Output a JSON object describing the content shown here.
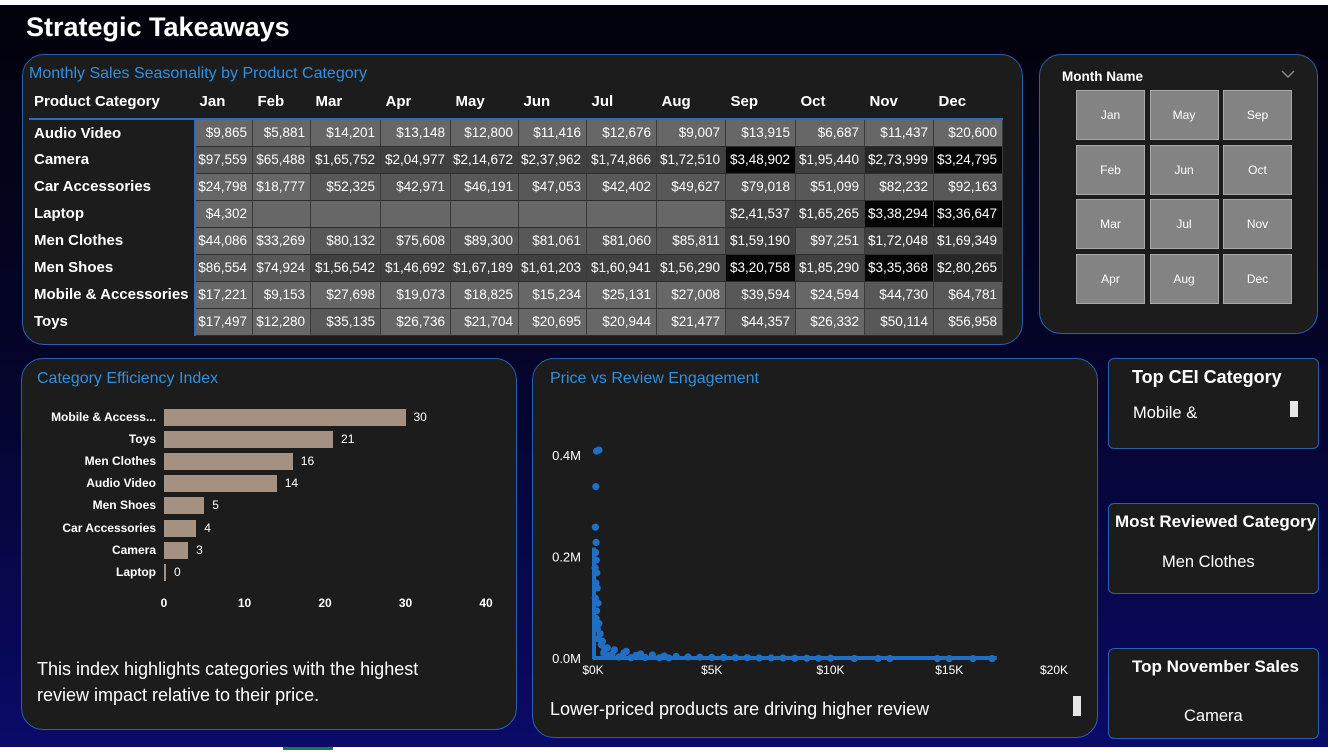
{
  "page": {
    "title": "Strategic Takeaways"
  },
  "seasonality": {
    "title": "Monthly Sales Seasonality by Product Category",
    "header": [
      "Product Category",
      "Jan",
      "Feb",
      "Mar",
      "Apr",
      "May",
      "Jun",
      "Jul",
      "Aug",
      "Sep",
      "Oct",
      "Nov",
      "Dec"
    ],
    "rows": [
      {
        "name": "Audio Video",
        "cells": [
          "$9,865",
          "$5,881",
          "$14,201",
          "$13,148",
          "$12,800",
          "$11,416",
          "$12,676",
          "$9,007",
          "$13,915",
          "$6,687",
          "$11,437",
          "$20,600"
        ],
        "shade": [
          1,
          1,
          1,
          1,
          1,
          1,
          1,
          1,
          1,
          1,
          1,
          1
        ]
      },
      {
        "name": "Camera",
        "cells": [
          "$97,559",
          "$65,488",
          "$1,65,752",
          "$2,04,977",
          "$2,14,672",
          "$2,37,962",
          "$1,74,866",
          "$1,72,510",
          "$3,48,902",
          "$1,95,440",
          "$2,73,999",
          "$3,24,795"
        ],
        "shade": [
          2,
          2,
          3,
          3,
          3,
          3,
          3,
          3,
          5,
          3,
          4,
          5
        ]
      },
      {
        "name": "Car Accessories",
        "cells": [
          "$24,798",
          "$18,777",
          "$52,325",
          "$42,971",
          "$46,191",
          "$47,053",
          "$42,402",
          "$49,627",
          "$79,018",
          "$51,099",
          "$82,232",
          "$92,163"
        ],
        "shade": [
          1,
          1,
          2,
          2,
          2,
          2,
          2,
          2,
          2,
          2,
          2,
          2
        ]
      },
      {
        "name": "Laptop",
        "cells": [
          "$4,302",
          "",
          "",
          "",
          "",
          "",
          "",
          "",
          "$2,41,537",
          "$1,65,265",
          "$3,38,294",
          "$3,36,647"
        ],
        "shade": [
          1,
          1,
          1,
          1,
          1,
          1,
          1,
          1,
          3,
          3,
          5,
          5
        ]
      },
      {
        "name": "Men Clothes",
        "cells": [
          "$44,086",
          "$33,269",
          "$80,132",
          "$75,608",
          "$89,300",
          "$81,061",
          "$81,060",
          "$85,811",
          "$1,59,190",
          "$97,251",
          "$1,72,048",
          "$1,69,349"
        ],
        "shade": [
          1,
          1,
          2,
          2,
          2,
          2,
          2,
          2,
          3,
          2,
          3,
          3
        ]
      },
      {
        "name": "Men Shoes",
        "cells": [
          "$86,554",
          "$74,924",
          "$1,56,542",
          "$1,46,692",
          "$1,67,189",
          "$1,61,203",
          "$1,60,941",
          "$1,56,290",
          "$3,20,758",
          "$1,85,290",
          "$3,35,368",
          "$2,80,265"
        ],
        "shade": [
          2,
          2,
          3,
          3,
          3,
          3,
          3,
          3,
          5,
          3,
          5,
          4
        ]
      },
      {
        "name": "Mobile & Accessories",
        "cells": [
          "$17,221",
          "$9,153",
          "$27,698",
          "$19,073",
          "$18,825",
          "$15,234",
          "$25,131",
          "$27,008",
          "$39,594",
          "$24,594",
          "$44,730",
          "$64,781"
        ],
        "shade": [
          1,
          1,
          1,
          1,
          1,
          1,
          1,
          1,
          2,
          1,
          2,
          2
        ]
      },
      {
        "name": "Toys",
        "cells": [
          "$17,497",
          "$12,280",
          "$35,135",
          "$26,736",
          "$21,704",
          "$20,695",
          "$20,944",
          "$21,477",
          "$44,357",
          "$26,332",
          "$50,114",
          "$56,958"
        ],
        "shade": [
          1,
          1,
          2,
          1,
          1,
          1,
          1,
          1,
          2,
          1,
          2,
          2
        ]
      }
    ],
    "shade_colors": [
      "#1c1c1c",
      "#676767",
      "#585858",
      "#404040",
      "#262626",
      "#050505"
    ]
  },
  "slicer": {
    "title": "Month Name",
    "chevron_icon": "chevron-down-icon",
    "months": [
      "Jan",
      "May",
      "Sep",
      "Feb",
      "Jun",
      "Oct",
      "Mar",
      "Jul",
      "Nov",
      "Apr",
      "Aug",
      "Dec"
    ]
  },
  "cei": {
    "title": "Category Efficiency Index",
    "caption_line1": "This index highlights categories with the highest",
    "caption_line2": "review impact relative to their price."
  },
  "scatter": {
    "title": "Price vs Review Engagement",
    "caption": "Lower-priced products are driving higher review",
    "point_color": "#1f6fc4"
  },
  "cards": {
    "top_cei": {
      "title": "Top CEI Category",
      "value": "Mobile &"
    },
    "most_reviewed": {
      "title": "Most Reviewed Category",
      "value": "Men Clothes"
    },
    "top_november": {
      "title": "Top November Sales",
      "value": "Camera"
    }
  },
  "chart_data": [
    {
      "type": "bar",
      "title": "Category Efficiency Index",
      "categories": [
        "Mobile & Access...",
        "Toys",
        "Men Clothes",
        "Audio Video",
        "Men Shoes",
        "Car Accessories",
        "Camera",
        "Laptop"
      ],
      "values": [
        30,
        21,
        16,
        14,
        5,
        4,
        3,
        0
      ],
      "xlim": [
        0,
        40
      ],
      "xticks": [
        "0",
        "10",
        "20",
        "30",
        "40"
      ],
      "bar_color": "#a59182",
      "orientation": "horizontal"
    },
    {
      "type": "scatter",
      "title": "Price vs Review Engagement",
      "xlim": [
        0,
        20000
      ],
      "ylim": [
        0,
        430000
      ],
      "xticks": [
        {
          "v": 0,
          "label": "$0K"
        },
        {
          "v": 5000,
          "label": "$5K"
        },
        {
          "v": 10000,
          "label": "$10K"
        },
        {
          "v": 15000,
          "label": "$15K"
        },
        {
          "v": 20000,
          "label": "$20K"
        }
      ],
      "yticks": [
        {
          "v": 0,
          "label": "0.0M"
        },
        {
          "v": 200000,
          "label": "0.2M"
        },
        {
          "v": 400000,
          "label": "0.4M"
        }
      ],
      "points": [
        [
          150,
          410000
        ],
        [
          250,
          412000
        ],
        [
          120,
          340000
        ],
        [
          100,
          260000
        ],
        [
          130,
          230000
        ],
        [
          110,
          210000
        ],
        [
          140,
          195000
        ],
        [
          90,
          180000
        ],
        [
          160,
          170000
        ],
        [
          120,
          150000
        ],
        [
          180,
          140000
        ],
        [
          100,
          120000
        ],
        [
          210,
          110000
        ],
        [
          150,
          95000
        ],
        [
          130,
          80000
        ],
        [
          250,
          70000
        ],
        [
          180,
          60000
        ],
        [
          300,
          50000
        ],
        [
          220,
          40000
        ],
        [
          400,
          35000
        ],
        [
          350,
          28000
        ],
        [
          600,
          22000
        ],
        [
          500,
          20000
        ],
        [
          900,
          18000
        ],
        [
          1400,
          15000
        ],
        [
          1300,
          12000
        ],
        [
          2000,
          10000
        ],
        [
          2500,
          8000
        ],
        [
          1800,
          7000
        ],
        [
          3000,
          6000
        ],
        [
          3500,
          5000
        ],
        [
          4000,
          4000
        ],
        [
          4500,
          3500
        ],
        [
          5000,
          3000
        ],
        [
          5500,
          3000
        ],
        [
          6000,
          2500
        ],
        [
          6500,
          2500
        ],
        [
          7000,
          2000
        ],
        [
          7500,
          2000
        ],
        [
          8000,
          2000
        ],
        [
          8500,
          1500
        ],
        [
          9000,
          1500
        ],
        [
          9500,
          1500
        ],
        [
          10000,
          1500
        ],
        [
          11000,
          1000
        ],
        [
          12000,
          1000
        ],
        [
          12500,
          1000
        ],
        [
          14500,
          800
        ],
        [
          15000,
          800
        ],
        [
          16000,
          800
        ],
        [
          16800,
          800
        ],
        [
          700,
          5000
        ],
        [
          1100,
          4000
        ],
        [
          2200,
          3000
        ],
        [
          2800,
          2500
        ],
        [
          3200,
          2000
        ],
        [
          1600,
          2500
        ],
        [
          800,
          9000
        ],
        [
          450,
          12000
        ],
        [
          650,
          7000
        ]
      ]
    }
  ]
}
